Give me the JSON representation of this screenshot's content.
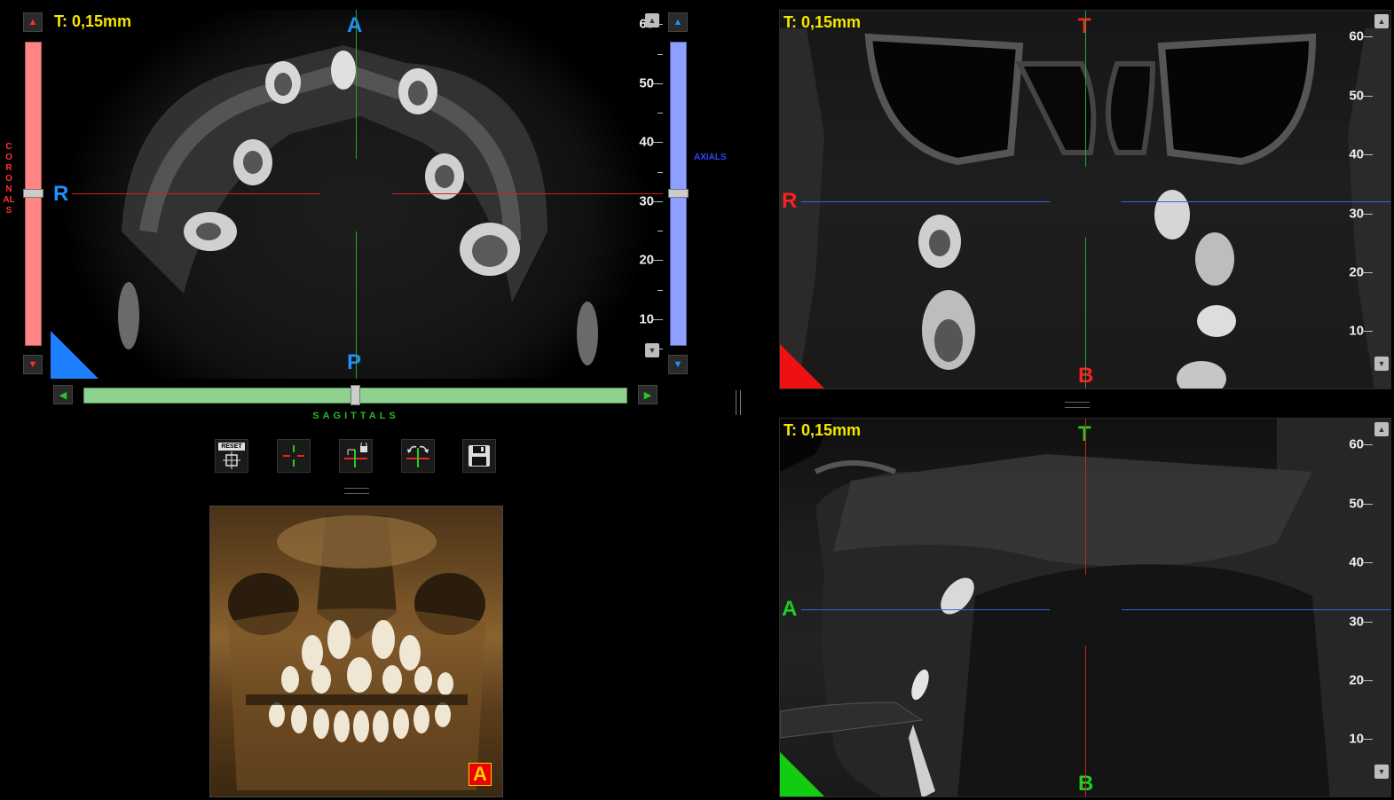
{
  "axial_view": {
    "thickness": "T: 0,15mm",
    "orient_top": "A",
    "orient_bottom": "P",
    "orient_left": "R",
    "ruler_labels": [
      "60",
      "50",
      "40",
      "30",
      "20",
      "10"
    ]
  },
  "coronal_view": {
    "thickness": "T: 0,15mm",
    "orient_top": "T",
    "orient_bottom": "B",
    "orient_left": "R",
    "ruler_labels": [
      "60",
      "50",
      "40",
      "30",
      "20",
      "10"
    ]
  },
  "sagittal_view": {
    "thickness": "T: 0,15mm",
    "orient_top": "T",
    "orient_bottom": "B",
    "orient_left": "A",
    "ruler_labels": [
      "60",
      "50",
      "40",
      "30",
      "20",
      "10"
    ]
  },
  "sliders": {
    "coronals_label": "CORONALS",
    "axials_label": "AXIALS",
    "sagittals_label": "SAGITTALS"
  },
  "toolbar": {
    "reset_label": "RESET"
  },
  "render3d": {
    "badge": "A"
  },
  "colors": {
    "coronal": "#ff7f7f",
    "axial": "#90a0ff",
    "sagittal": "#8fd18f",
    "thickness_text": "#f5e600",
    "axial_orient": "#1e90ff",
    "coronal_orient": "#ff2020",
    "sagittal_orient": "#22cc22"
  }
}
